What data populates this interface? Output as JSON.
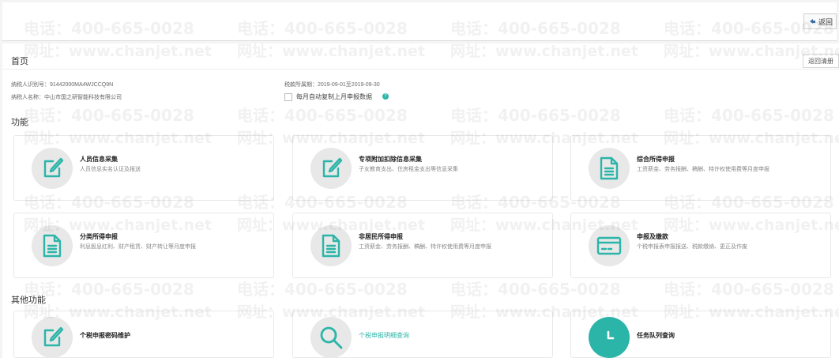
{
  "header": {
    "back_label": "返回"
  },
  "page": {
    "title": "首页",
    "back_list_label": "返回清册",
    "taxpayer_id_label": "纳税人识别号：91442000MA4WJCCQ9N",
    "taxpayer_name_label": "纳税人名称：中山市国之研智能科技有限公司",
    "period_label": "税款所属期：2019-09-01至2019-09-30",
    "auto_copy_label": "每月自动复制上月申报数据",
    "help_glyph": "?"
  },
  "functions": {
    "title": "功能",
    "items": [
      {
        "title": "人员信息采集",
        "desc": "人员信息实名认证及报送",
        "icon": "edit-icon"
      },
      {
        "title": "专项附加扣除信息采集",
        "desc": "子女教育支出、住房租金支出等信息采集",
        "icon": "edit-icon"
      },
      {
        "title": "综合所得申报",
        "desc": "工资薪金、劳务报酬、稿酬、特许权使用费等月度申报",
        "icon": "document-icon"
      },
      {
        "title": "分类所得申报",
        "desc": "利息股息红利、财产租赁、财产转让等月度申报",
        "icon": "document-icon"
      },
      {
        "title": "非居民所得申报",
        "desc": "工资薪金、劳务报酬、稿酬、特许权使用费等月度申报",
        "icon": "document-icon"
      },
      {
        "title": "申报及缴款",
        "desc": "个税申报表申报报送、税款缴纳、更正及作废",
        "icon": "card-icon"
      }
    ]
  },
  "other_functions": {
    "title": "其他功能",
    "items": [
      {
        "title": "个税申报密码维护",
        "icon": "edit-icon"
      },
      {
        "title": "个税申报明细查询",
        "icon": "search-icon"
      },
      {
        "title": "任务队列查询",
        "icon": "clock-icon"
      }
    ]
  },
  "watermark": {
    "phone": "电话：400-665-0028",
    "site": "网址：www.chanjet.net"
  },
  "colors": {
    "accent": "#2bb5a8",
    "icon_bg": "#e8e8e8"
  }
}
